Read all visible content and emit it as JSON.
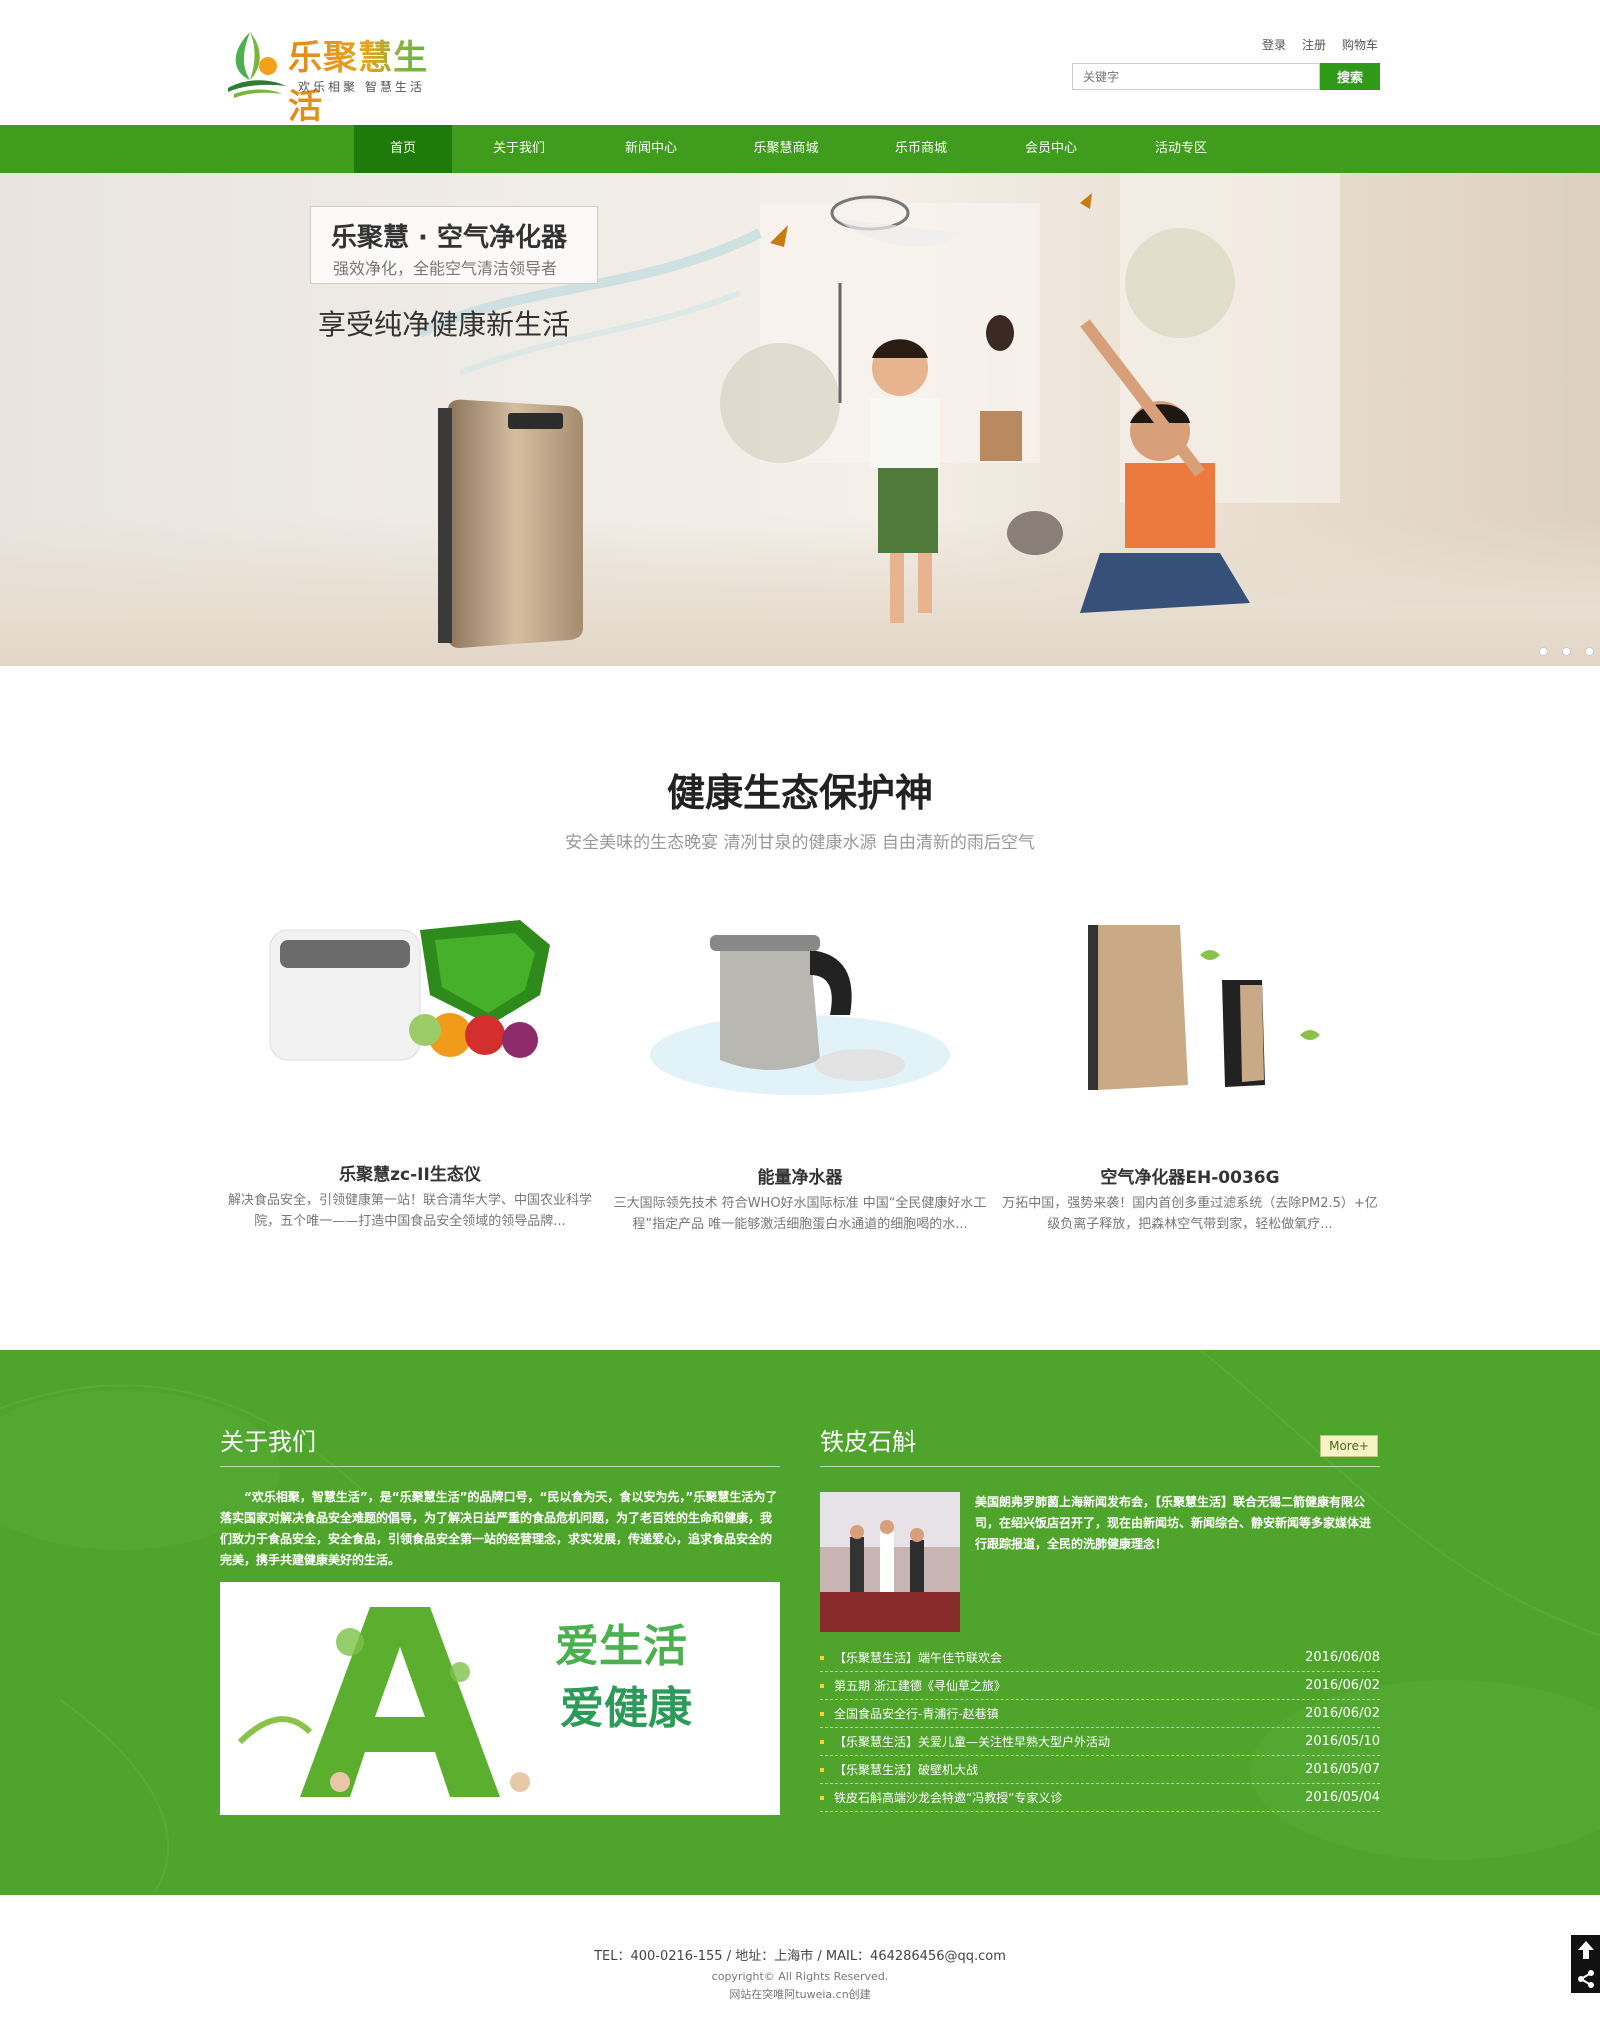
{
  "brand": {
    "title": "乐聚慧生活",
    "slogan": "欢乐相聚  智慧生活",
    "colors": {
      "primary": "#3f9c1d",
      "primary_dark": "#1f7b09",
      "accent": "#e6a21e"
    }
  },
  "top_links": [
    "登录",
    "注册",
    "购物车"
  ],
  "search": {
    "placeholder": "关键字",
    "button": "搜索"
  },
  "nav": [
    {
      "label": "首页",
      "active": true
    },
    {
      "label": "关于我们"
    },
    {
      "label": "新闻中心"
    },
    {
      "label": "乐聚慧商城"
    },
    {
      "label": "乐币商城"
    },
    {
      "label": "会员中心"
    },
    {
      "label": "活动专区"
    }
  ],
  "banner": {
    "title": "乐聚慧 · 空气净化器",
    "subtitle": "强效净化，全能空气清洁领导者",
    "slogan": "享受纯净健康新生活",
    "slides": 3
  },
  "products_section": {
    "title": "健康生态保护神",
    "subtitle": "安全美味的生态晚宴  清冽甘泉的健康水源  自由清新的雨后空气",
    "items": [
      {
        "name": "乐聚慧zc-II生态仪",
        "desc": "解决食品安全，引领健康第一站！联合清华大学、中国农业科学院，五个唯一——打造中国食品安全领域的领导品牌..."
      },
      {
        "name": "能量净水器",
        "desc": "三大国际领先技术 符合WHO好水国际标准    中国“全民健康好水工程”指定产品    唯一能够激活细胞蛋白水通道的细胞喝的水..."
      },
      {
        "name": "空气净化器EH-0036G",
        "desc": "万拓中国，强势来袭！国内首创多重过滤系统（去除PM2.5）+亿级负离子释放，把森林空气带到家，轻松做氧疗..."
      }
    ]
  },
  "about": {
    "title": "关于我们",
    "text": "“欢乐相聚，智慧生活”，是“乐聚慧生活”的品牌口号，“民以食为天，食以安为先，”乐聚慧生活为了落实国家对解决食品安全难题的倡导，为了解决日益严重的食品危机问题，为了老百姓的生命和健康，我们致力于食品安全，安全食品，引领食品安全第一站的经营理念，求实发展，传递爱心，追求食品安全的完美，携手共建健康美好的生活。",
    "image_text": {
      "line1": "爱生活",
      "line2": "爱健康"
    }
  },
  "news": {
    "title": "铁皮石斛",
    "more": "More+",
    "summary": "美国朗弗罗肺菌上海新闻发布会，【乐聚慧生活】联合无锡二箭健康有限公司，在绍兴饭店召开了，现在由新闻坊、新闻综合、静安新闻等多家媒体进行跟踪报道，全民的洗肺健康理念！",
    "items": [
      {
        "title": "【乐聚慧生活】端午佳节联欢会",
        "date": "2016/06/08"
      },
      {
        "title": "第五期 浙江建德《寻仙草之旅》",
        "date": "2016/06/02"
      },
      {
        "title": "全国食品安全行-青浦行-赵巷镇",
        "date": "2016/06/02"
      },
      {
        "title": "【乐聚慧生活】关爱儿童—关注性早熟大型户外活动",
        "date": "2016/05/10"
      },
      {
        "title": "【乐聚慧生活】破壁机大战",
        "date": "2016/05/07"
      },
      {
        "title": "铁皮石斛高端沙龙会特邀“冯教授”专家义诊",
        "date": "2016/05/04"
      }
    ]
  },
  "footer": {
    "contact": "TEL：400-0216-155   /   地址：上海市   /   MAIL：464286456@qq.com",
    "copyright": "copyright© All Rights Reserved.",
    "built": "网站在突唯阿tuweia.cn创建"
  },
  "side_tools": {
    "top_icon": "arrow-up-icon",
    "share_icon": "share-icon"
  }
}
